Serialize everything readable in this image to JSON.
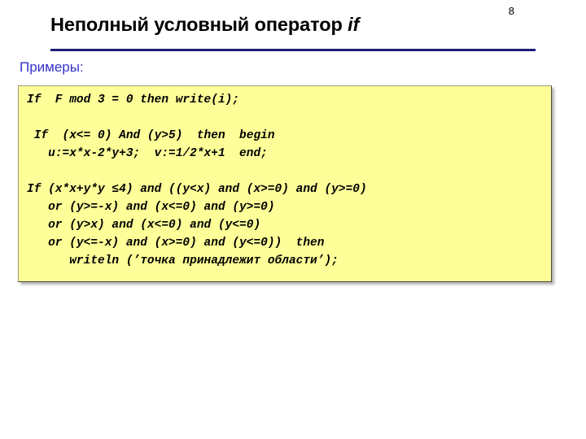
{
  "slide": {
    "number": "8",
    "title_main": "Неполный условный оператор ",
    "title_keyword": "if",
    "subtitle": "Примеры:",
    "accent_rule_color": "#1d1d78",
    "subtitle_color": "#3333cc",
    "code_box_background": "#ffff99",
    "code_text_color": "#000000"
  },
  "code": {
    "lines": [
      "If  F mod 3 = 0 then write(i);",
      "",
      " If  (x<= 0) And (y>5)  then  begin",
      "   u:=x*x-2*y+3;  v:=1/2*x+1  end;",
      "",
      "If (x*x+y*y ≤4) and ((y<x) and (x>=0) and (y>=0)",
      "   or (y>=-x) and (x<=0) and (y>=0)",
      "   or (y>x) and (x<=0) and (y<=0)",
      "   or (y<=-x) and (x>=0) and (y<=0))  then",
      "      writeln (’точка принадлежит области’);"
    ]
  }
}
